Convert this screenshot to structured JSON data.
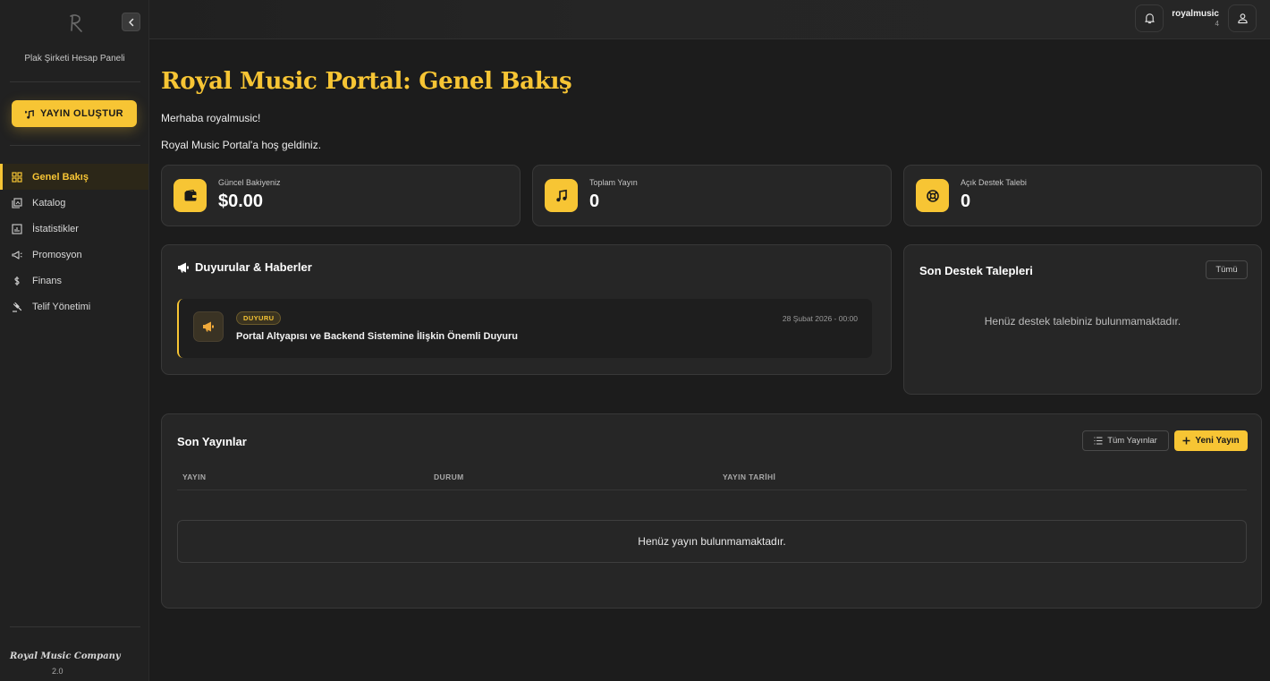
{
  "sidebar": {
    "subtitle": "Plak Şirketi Hesap Paneli",
    "create_button": "YAYIN OLUŞTUR",
    "items": [
      {
        "label": "Genel Bakış",
        "icon": "dashboard-grid-icon",
        "active": true
      },
      {
        "label": "Katalog",
        "icon": "catalog-icon",
        "active": false
      },
      {
        "label": "İstatistikler",
        "icon": "chart-icon",
        "active": false
      },
      {
        "label": "Promosyon",
        "icon": "megaphone-icon",
        "active": false
      },
      {
        "label": "Finans",
        "icon": "dollar-icon",
        "active": false
      },
      {
        "label": "Telif Yönetimi",
        "icon": "gavel-icon",
        "active": false
      }
    ],
    "company": "Royal Music Company",
    "version": "2.0"
  },
  "topbar": {
    "username": "royalmusic",
    "user_count": "4"
  },
  "main": {
    "title": "Royal Music Portal: Genel Bakış",
    "greeting": "Merhaba royalmusic!",
    "welcome": "Royal Music Portal'a hoş geldiniz."
  },
  "stats": [
    {
      "label": "Güncel Bakiyeniz",
      "value": "$0.00",
      "icon": "wallet-icon"
    },
    {
      "label": "Toplam Yayın",
      "value": "0",
      "icon": "music-note-icon"
    },
    {
      "label": "Açık Destek Talebi",
      "value": "0",
      "icon": "lifebuoy-icon"
    }
  ],
  "announcements": {
    "title": "Duyurular & Haberler",
    "items": [
      {
        "badge": "DUYURU",
        "date": "28 Şubat 2026 - 00:00",
        "title": "Portal Altyapısı ve Backend Sistemine İlişkin Önemli Duyuru"
      }
    ]
  },
  "support": {
    "title": "Son Destek Talepleri",
    "all_button": "Tümü",
    "empty": "Henüz destek talebiniz bulunmamaktadır."
  },
  "releases": {
    "title": "Son Yayınlar",
    "all_button": "Tüm Yayınlar",
    "new_button": "Yeni Yayın",
    "columns": [
      "YAYIN",
      "DURUM",
      "YAYIN TARİHİ"
    ],
    "empty": "Henüz yayın bulunmamaktadır."
  },
  "colors": {
    "accent": "#f7c534",
    "background": "#1c1c1c",
    "card": "#262626"
  }
}
